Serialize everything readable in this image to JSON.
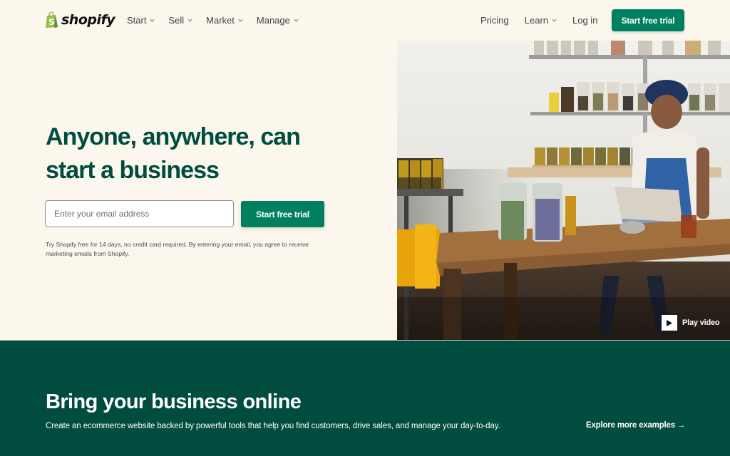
{
  "header": {
    "logo_text": "shopify",
    "nav_left": [
      {
        "label": "Start",
        "has_dropdown": true
      },
      {
        "label": "Sell",
        "has_dropdown": true
      },
      {
        "label": "Market",
        "has_dropdown": true
      },
      {
        "label": "Manage",
        "has_dropdown": true
      }
    ],
    "nav_right": [
      {
        "label": "Pricing",
        "has_dropdown": false
      },
      {
        "label": "Learn",
        "has_dropdown": true
      },
      {
        "label": "Log in",
        "has_dropdown": false
      }
    ],
    "cta_label": "Start free trial"
  },
  "hero": {
    "title": "Anyone, anywhere, can start a business",
    "email_placeholder": "Enter your email address",
    "email_value": "",
    "cta_label": "Start free trial",
    "disclaimer": "Try Shopify free for 14 days, no credit card required. By entering your email, you agree to receive marketing emails from Shopify.",
    "image_description": "Woman in headscarf and denim apron using a tablet at a wooden table with jars of herbs on shelves",
    "play_label": "Play video"
  },
  "band": {
    "title": "Bring your business online",
    "subtitle": "Create an ecommerce website backed by powerful tools that help you find customers, drive sales, and manage your day-to-day.",
    "link_label": "Explore more examples →"
  },
  "colors": {
    "brand_green": "#008060",
    "dark_green": "#004c3f",
    "cream_bg": "#fbf7ed",
    "logo_green": "#95bf47"
  }
}
